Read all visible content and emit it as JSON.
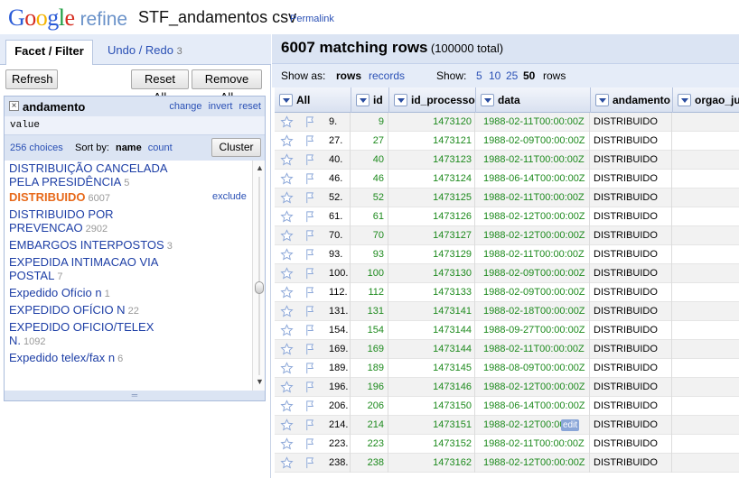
{
  "header": {
    "logo_google": "Google",
    "logo_refine": "refine",
    "project_name": "STF_andamentos csv",
    "permalink": "Permalink"
  },
  "left": {
    "tab_facet": "Facet / Filter",
    "tab_undo": "Undo / Redo",
    "tab_undo_count": "3",
    "refresh": "Refresh",
    "reset_all": "Reset All",
    "remove_all": "Remove All",
    "facet": {
      "title": "andamento",
      "change": "change",
      "invert": "invert",
      "reset": "reset",
      "expression": "value",
      "choices": "256 choices",
      "sort_by": "Sort by:",
      "sort_name": "name",
      "sort_count": "count",
      "cluster": "Cluster",
      "exclude": "exclude",
      "items": [
        {
          "line1": "DISTRIBUIÇÃO CANCELADA",
          "line2": "PELA PRESIDÊNCIA",
          "count": "5"
        },
        {
          "line1": "DISTRIBUIDO",
          "line2": "",
          "count": "6007"
        },
        {
          "line1": "DISTRIBUIDO POR",
          "line2": "PREVENCAO",
          "count": "2902"
        },
        {
          "line1": "EMBARGOS INTERPOSTOS",
          "line2": "",
          "count": "3"
        },
        {
          "line1": "EXPEDIDA INTIMACAO VIA",
          "line2": "POSTAL",
          "count": "7"
        },
        {
          "line1": "Expedido Ofício n",
          "line2": "",
          "count": "1"
        },
        {
          "line1": "EXPEDIDO OFÍCIO N",
          "line2": "",
          "count": "22"
        },
        {
          "line1": "EXPEDIDO OFICIO/TELEX",
          "line2": "N.",
          "count": "1092"
        },
        {
          "line1": "Expedido telex/fax n",
          "line2": "",
          "count": "6"
        }
      ]
    }
  },
  "right": {
    "matching": "6007 matching rows",
    "total": "(100000 total)",
    "show_as": "Show as:",
    "rows": "rows",
    "records": "records",
    "show": "Show:",
    "opt5": "5",
    "opt10": "10",
    "opt25": "25",
    "opt50": "50",
    "rows_label": "rows",
    "columns": [
      "All",
      "id",
      "id_processo",
      "data",
      "andamento",
      "orgao_jul"
    ],
    "edit_label": "edit",
    "table": [
      {
        "idx": "9.",
        "id": "9",
        "proc": "1473120",
        "data": "1988-02-11T00:00:00Z",
        "and": "DISTRIBUIDO"
      },
      {
        "idx": "27.",
        "id": "27",
        "proc": "1473121",
        "data": "1988-02-09T00:00:00Z",
        "and": "DISTRIBUIDO"
      },
      {
        "idx": "40.",
        "id": "40",
        "proc": "1473123",
        "data": "1988-02-11T00:00:00Z",
        "and": "DISTRIBUIDO"
      },
      {
        "idx": "46.",
        "id": "46",
        "proc": "1473124",
        "data": "1988-06-14T00:00:00Z",
        "and": "DISTRIBUIDO"
      },
      {
        "idx": "52.",
        "id": "52",
        "proc": "1473125",
        "data": "1988-02-11T00:00:00Z",
        "and": "DISTRIBUIDO"
      },
      {
        "idx": "61.",
        "id": "61",
        "proc": "1473126",
        "data": "1988-02-12T00:00:00Z",
        "and": "DISTRIBUIDO"
      },
      {
        "idx": "70.",
        "id": "70",
        "proc": "1473127",
        "data": "1988-02-12T00:00:00Z",
        "and": "DISTRIBUIDO"
      },
      {
        "idx": "93.",
        "id": "93",
        "proc": "1473129",
        "data": "1988-02-11T00:00:00Z",
        "and": "DISTRIBUIDO"
      },
      {
        "idx": "100.",
        "id": "100",
        "proc": "1473130",
        "data": "1988-02-09T00:00:00Z",
        "and": "DISTRIBUIDO"
      },
      {
        "idx": "112.",
        "id": "112",
        "proc": "1473133",
        "data": "1988-02-09T00:00:00Z",
        "and": "DISTRIBUIDO"
      },
      {
        "idx": "131.",
        "id": "131",
        "proc": "1473141",
        "data": "1988-02-18T00:00:00Z",
        "and": "DISTRIBUIDO"
      },
      {
        "idx": "154.",
        "id": "154",
        "proc": "1473144",
        "data": "1988-09-27T00:00:00Z",
        "and": "DISTRIBUIDO"
      },
      {
        "idx": "169.",
        "id": "169",
        "proc": "1473144",
        "data": "1988-02-11T00:00:00Z",
        "and": "DISTRIBUIDO"
      },
      {
        "idx": "189.",
        "id": "189",
        "proc": "1473145",
        "data": "1988-08-09T00:00:00Z",
        "and": "DISTRIBUIDO"
      },
      {
        "idx": "196.",
        "id": "196",
        "proc": "1473146",
        "data": "1988-02-12T00:00:00Z",
        "and": "DISTRIBUIDO"
      },
      {
        "idx": "206.",
        "id": "206",
        "proc": "1473150",
        "data": "1988-06-14T00:00:00Z",
        "and": "DISTRIBUIDO"
      },
      {
        "idx": "214.",
        "id": "214",
        "proc": "1473151",
        "data": "1988-02-12T00:00",
        "and": "DISTRIBUIDO"
      },
      {
        "idx": "223.",
        "id": "223",
        "proc": "1473152",
        "data": "1988-02-11T00:00:00Z",
        "and": "DISTRIBUIDO"
      },
      {
        "idx": "238.",
        "id": "238",
        "proc": "1473162",
        "data": "1988-02-12T00:00:00Z",
        "and": "DISTRIBUIDO"
      }
    ]
  }
}
